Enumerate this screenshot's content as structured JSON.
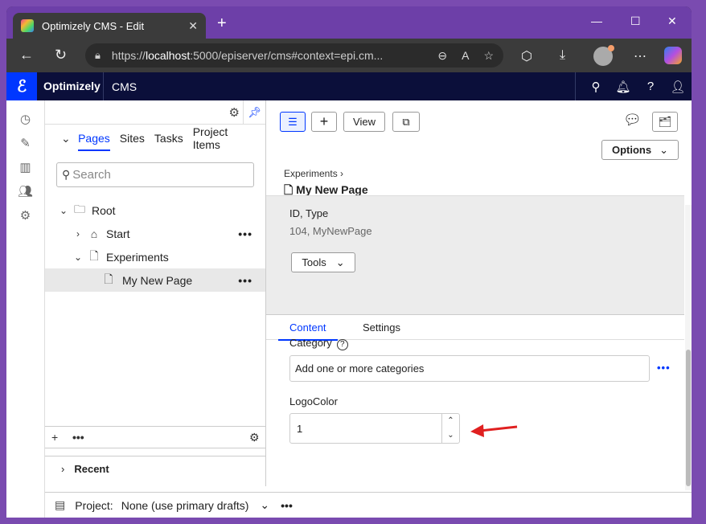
{
  "browser": {
    "tab_title": "Optimizely CMS - Edit",
    "tab_close": "✕",
    "new_tab": "+",
    "url_prefix": "https://",
    "url_host": "localhost",
    "url_rest": ":5000/episerver/cms#context=epi.cm...",
    "window_controls": [
      "—",
      "☐",
      "✕"
    ]
  },
  "cms": {
    "brand": "Optimizely",
    "product": "CMS"
  },
  "nav_panel": {
    "tabs": [
      "Pages",
      "Sites",
      "Tasks",
      "Project Items"
    ],
    "active_tab": "Pages",
    "search_placeholder": "Search",
    "tree": [
      {
        "label": "Root",
        "level": 0,
        "expanded": true
      },
      {
        "label": "Start",
        "level": 1,
        "expanded": false
      },
      {
        "label": "Experiments",
        "level": 1,
        "expanded": true
      },
      {
        "label": "My New Page",
        "level": 2,
        "selected": true
      }
    ],
    "recent_label": "Recent"
  },
  "project_bar": {
    "label": "Project:",
    "value": "None (use primary drafts)"
  },
  "editor": {
    "view_button": "View",
    "options_button": "Options",
    "breadcrumb_parent": "Experiments",
    "page_title": "My New Page",
    "info_label": "ID, Type",
    "info_value": "104, MyNewPage",
    "tools_button": "Tools",
    "content_tabs": [
      "Content",
      "Settings"
    ],
    "category_label": "Category",
    "category_value": "Add one or more categories",
    "logocolor_label": "LogoColor",
    "logocolor_value": "1"
  },
  "colors": {
    "accent": "#0037ff",
    "cms_header": "#0b0f3a",
    "browser_frame": "#7a4bb0",
    "annotation_arrow": "#e02020"
  }
}
